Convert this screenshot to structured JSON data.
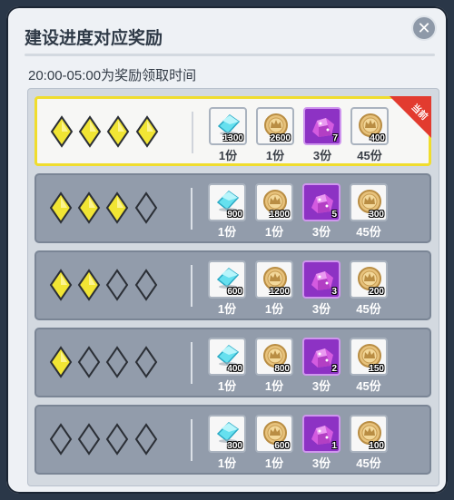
{
  "title": "建设进度对应奖励",
  "subtitle": "20:00-05:00为奖励领取时间",
  "current_badge": "当前",
  "colors": {
    "gem_filled": "#f1e534",
    "current_border": "#f0dd2d",
    "badge": "#e23b2f",
    "purple_item": "#8d32c4"
  },
  "rows": [
    {
      "gems_filled": 4,
      "current": true,
      "items": [
        {
          "icon": "blue-crystal-icon",
          "qty": "1300",
          "share": "1份"
        },
        {
          "icon": "gold-coin-icon",
          "qty": "2600",
          "share": "1份"
        },
        {
          "icon": "purple-gem-pile-icon",
          "qty": "7",
          "share": "3份"
        },
        {
          "icon": "gold-coin-icon",
          "qty": "400",
          "share": "45份"
        }
      ]
    },
    {
      "gems_filled": 3,
      "current": false,
      "items": [
        {
          "icon": "blue-crystal-icon",
          "qty": "900",
          "share": "1份"
        },
        {
          "icon": "gold-coin-icon",
          "qty": "1800",
          "share": "1份"
        },
        {
          "icon": "purple-gem-pile-icon",
          "qty": "5",
          "share": "3份"
        },
        {
          "icon": "gold-coin-icon",
          "qty": "300",
          "share": "45份"
        }
      ]
    },
    {
      "gems_filled": 2,
      "current": false,
      "items": [
        {
          "icon": "blue-crystal-icon",
          "qty": "600",
          "share": "1份"
        },
        {
          "icon": "gold-coin-icon",
          "qty": "1200",
          "share": "1份"
        },
        {
          "icon": "purple-gem-pile-icon",
          "qty": "3",
          "share": "3份"
        },
        {
          "icon": "gold-coin-icon",
          "qty": "200",
          "share": "45份"
        }
      ]
    },
    {
      "gems_filled": 1,
      "current": false,
      "items": [
        {
          "icon": "blue-crystal-icon",
          "qty": "400",
          "share": "1份"
        },
        {
          "icon": "gold-coin-icon",
          "qty": "800",
          "share": "1份"
        },
        {
          "icon": "purple-gem-pile-icon",
          "qty": "2",
          "share": "3份"
        },
        {
          "icon": "gold-coin-icon",
          "qty": "150",
          "share": "45份"
        }
      ]
    },
    {
      "gems_filled": 0,
      "current": false,
      "items": [
        {
          "icon": "blue-crystal-icon",
          "qty": "300",
          "share": "1份"
        },
        {
          "icon": "gold-coin-icon",
          "qty": "600",
          "share": "1份"
        },
        {
          "icon": "purple-gem-pile-icon",
          "qty": "1",
          "share": "3份"
        },
        {
          "icon": "gold-coin-icon",
          "qty": "100",
          "share": "45份"
        }
      ]
    }
  ]
}
